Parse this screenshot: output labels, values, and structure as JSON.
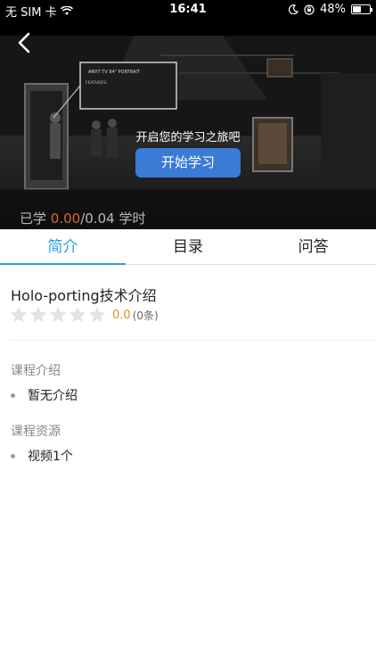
{
  "status_bar": {
    "carrier": "无 SIM 卡",
    "time": "16:41",
    "battery": "48%",
    "battery_level": 0.48
  },
  "video": {
    "overlay_text": "开启您的学习之旅吧",
    "start_button": "开始学习",
    "progress_prefix": "已学",
    "progress_done": "0.00",
    "progress_total": "/0.04",
    "progress_unit": "学时",
    "screen_title": "ARHT TV 84\" PORTRAIT",
    "screen_features": "FEATURES:"
  },
  "tabs": [
    {
      "label": "简介",
      "active": true
    },
    {
      "label": "目录",
      "active": false
    },
    {
      "label": "问答",
      "active": false
    }
  ],
  "course": {
    "title": "Holo-porting技术介绍",
    "rating_stars": 0,
    "rating_max": 5,
    "score": "0.0",
    "review_count": "(0条)"
  },
  "sections": {
    "intro_label": "课程介绍",
    "intro_item": "暂无介绍",
    "resources_label": "课程资源",
    "resources_item": "视频1个"
  },
  "colors": {
    "accent": "#2a9de4",
    "button": "#3a7bd5",
    "score": "#e08a2c",
    "star_empty": "#e3e3e3"
  }
}
